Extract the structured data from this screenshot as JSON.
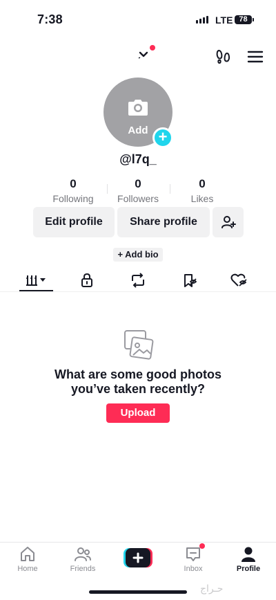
{
  "status_bar": {
    "time": "7:38",
    "network": "LTE",
    "battery": "78"
  },
  "profile": {
    "avatar_label": "Add",
    "username": "@l7q_",
    "stats": [
      {
        "value": "0",
        "label": "Following"
      },
      {
        "value": "0",
        "label": "Followers"
      },
      {
        "value": "0",
        "label": "Likes"
      }
    ],
    "edit_button": "Edit profile",
    "share_button": "Share profile",
    "add_bio": "+ Add bio"
  },
  "tabs": [
    {
      "icon": "grid-icon",
      "active": true
    },
    {
      "icon": "lock-icon"
    },
    {
      "icon": "repost-icon"
    },
    {
      "icon": "favorites-icon"
    },
    {
      "icon": "liked-icon"
    }
  ],
  "empty_state": {
    "icon": "photos-icon",
    "line1": "What are some good photos",
    "line2": "you’ve taken recently?",
    "button": "Upload"
  },
  "bottom_nav": [
    {
      "label": "Home",
      "icon": "home-icon"
    },
    {
      "label": "Friends",
      "icon": "friends-icon"
    },
    {
      "label": "",
      "icon": "create-icon"
    },
    {
      "label": "Inbox",
      "icon": "inbox-icon",
      "badge": true
    },
    {
      "label": "Profile",
      "icon": "profile-icon",
      "active": true
    }
  ],
  "watermark": "حـراج",
  "colors": {
    "accent": "#fe2c55",
    "cyan": "#20d5ec",
    "text": "#161823",
    "muted": "#8a8b91",
    "button_bg": "#f1f1f2"
  }
}
